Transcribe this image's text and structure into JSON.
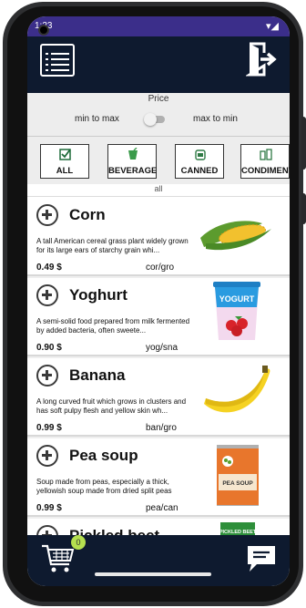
{
  "status": {
    "time": "1:23",
    "icons": "▾◢"
  },
  "price": {
    "title": "Price",
    "min_to_max": "min to max",
    "max_to_min": "max to min"
  },
  "categories": [
    {
      "label": "ALL",
      "icon": "checkbox-icon"
    },
    {
      "label": "BEVERAGE",
      "icon": "drink-icon"
    },
    {
      "label": "CANNED",
      "icon": "can-icon"
    },
    {
      "label": "CONDIMENT",
      "icon": "condiment-icon"
    }
  ],
  "filter_label": "all",
  "products": [
    {
      "name": "Corn",
      "desc": "A tall American cereal grass plant widely grown for its large ears of starchy grain whi...",
      "price": "0.49  $",
      "code": "cor/gro"
    },
    {
      "name": "Yoghurt",
      "desc": "A semi-solid food prepared from milk fermented by added bacteria, often sweete...",
      "price": "0.90  $",
      "code": "yog/sna",
      "img_text": "YOGURT"
    },
    {
      "name": "Banana",
      "desc": "A long curved fruit which grows in clusters and has soft pulpy flesh and yellow skin wh...",
      "price": "0.99  $",
      "code": "ban/gro"
    },
    {
      "name": "Pea soup",
      "desc": "Soup made from peas, especially a thick, yellowish soup made from dried split peas",
      "price": "0.99  $",
      "code": "pea/can",
      "img_text": "PEA SOUP"
    },
    {
      "name": "Pickled beet",
      "img_text": "PICKLED BEET"
    }
  ],
  "cart": {
    "count": "0"
  },
  "colors": {
    "appbar": "#0e1a2f",
    "statusbar": "#3b2e8a",
    "badge": "#b5e04f"
  }
}
